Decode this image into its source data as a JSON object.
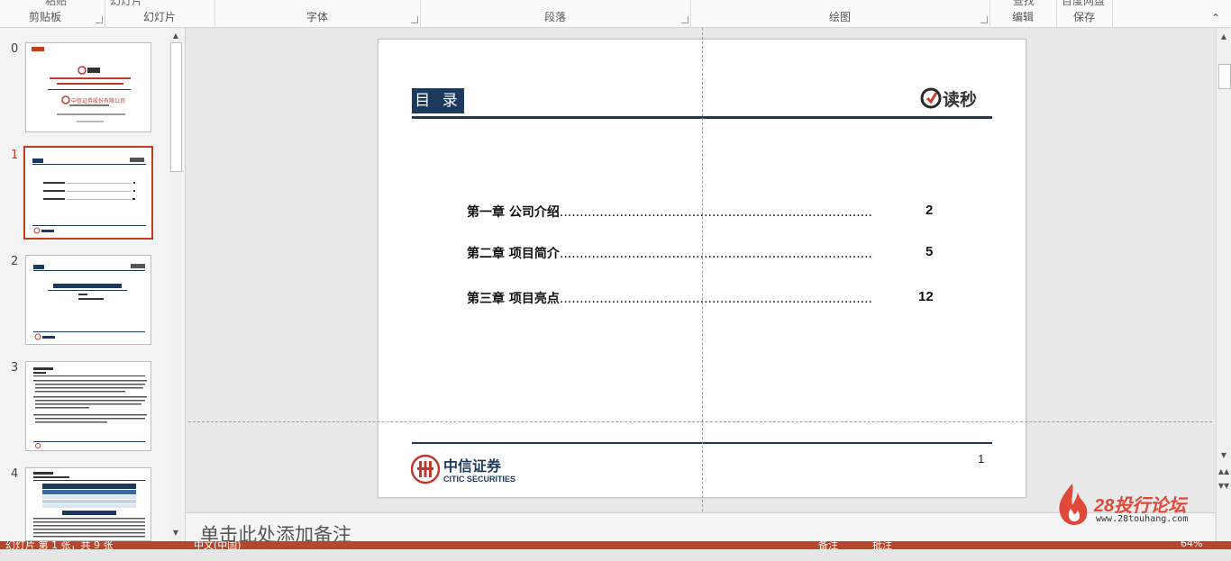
{
  "ribbon": {
    "top_texts": [
      "粘贴",
      "幻灯片",
      "",
      "",
      "",
      "",
      "",
      "查找",
      "百度网盘"
    ],
    "groups": [
      {
        "label": "剪贴板",
        "launcher": true
      },
      {
        "label": "幻灯片",
        "launcher": false
      },
      {
        "label": "字体",
        "launcher": true
      },
      {
        "label": "段落",
        "launcher": true
      },
      {
        "label": "绘图",
        "launcher": true
      },
      {
        "label": "编辑",
        "launcher": false
      },
      {
        "label": "保存",
        "launcher": false
      }
    ]
  },
  "thumbnails": {
    "numbers": [
      "0",
      "1",
      "2",
      "3",
      "4"
    ],
    "selected_index": 1,
    "cover_company": "中信证券股份有限公司"
  },
  "slide": {
    "title": "目 录",
    "brand_name": "读秒",
    "toc": [
      {
        "label": "第一章 公司介绍",
        "page": "2"
      },
      {
        "label": "第二章 项目简介",
        "page": "5"
      },
      {
        "label": "第三章 项目亮点",
        "page": "12"
      }
    ],
    "page_number": "1",
    "footer_logo_cn": "中信证券",
    "footer_logo_en": "CITIC SECURITIES"
  },
  "notes": {
    "placeholder": "单击此处添加备注"
  },
  "status": {
    "slide_info": "幻灯片 第 1 张，共 9 张",
    "language": "中文(中国)",
    "notes_button": "备注",
    "comments_button": "批注",
    "zoom": "64%"
  },
  "watermark": {
    "name": "28投行论坛",
    "url": "www.28touhang.com"
  },
  "colors": {
    "accent": "#c43e1c",
    "navy": "#1b3a5e",
    "status_bar": "#b7472a"
  }
}
